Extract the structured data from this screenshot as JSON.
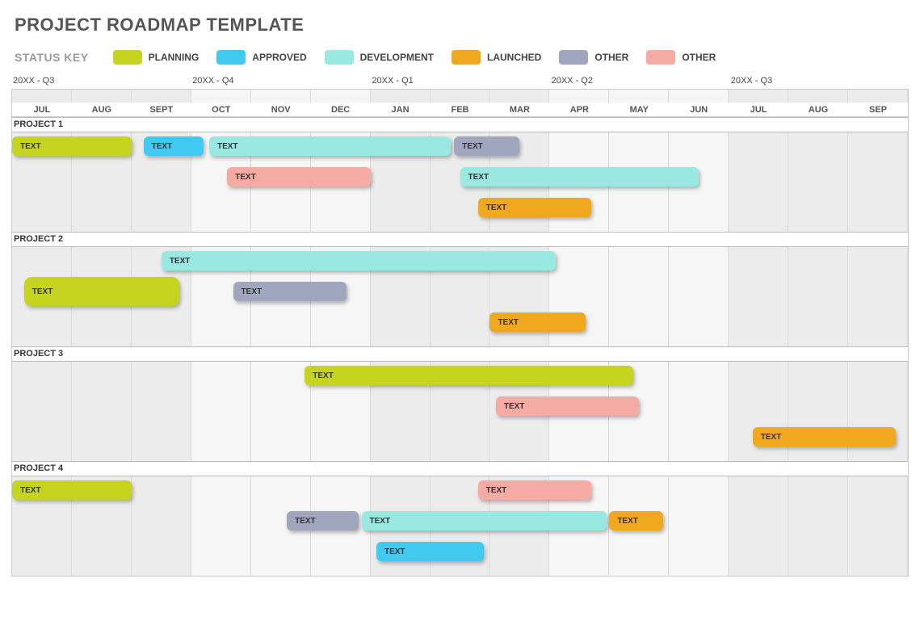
{
  "title": "PROJECT ROADMAP TEMPLATE",
  "legend": {
    "label": "STATUS KEY",
    "items": [
      {
        "key": "planning",
        "label": "PLANNING",
        "color": "#c6d420"
      },
      {
        "key": "approved",
        "label": "APPROVED",
        "color": "#41caf1"
      },
      {
        "key": "development",
        "label": "DEVELOPMENT",
        "color": "#9ae8e2"
      },
      {
        "key": "launched",
        "label": "LAUNCHED",
        "color": "#f0a81e"
      },
      {
        "key": "other1",
        "label": "OTHER",
        "color": "#9fa6bd"
      },
      {
        "key": "other2",
        "label": "OTHER",
        "color": "#f5aaa3"
      }
    ]
  },
  "months": [
    "JUL",
    "AUG",
    "SEPT",
    "OCT",
    "NOV",
    "DEC",
    "JAN",
    "FEB",
    "MAR",
    "APR",
    "MAY",
    "JUN",
    "JUL",
    "AUG",
    "SEP"
  ],
  "quarters": [
    {
      "label": "20XX - Q3",
      "start_month": 0
    },
    {
      "label": "20XX - Q4",
      "start_month": 3
    },
    {
      "label": "20XX - Q1",
      "start_month": 6
    },
    {
      "label": "20XX - Q2",
      "start_month": 9
    },
    {
      "label": "20XX - Q3",
      "start_month": 12
    }
  ],
  "projects": [
    {
      "name": "PROJECT 1",
      "rows": 3,
      "bars": [
        {
          "label": "TEXT",
          "status": "planning",
          "start": 0,
          "end": 2,
          "row": 0
        },
        {
          "label": "TEXT",
          "status": "approved",
          "start": 2.2,
          "end": 3.2,
          "row": 0
        },
        {
          "label": "TEXT",
          "status": "development",
          "start": 3.3,
          "end": 7.35,
          "row": 0
        },
        {
          "label": "TEXT",
          "status": "other1",
          "start": 7.4,
          "end": 8.5,
          "row": 0
        },
        {
          "label": "TEXT",
          "status": "other2",
          "start": 3.6,
          "end": 6,
          "row": 1
        },
        {
          "label": "TEXT",
          "status": "development",
          "start": 7.5,
          "end": 11.5,
          "row": 1
        },
        {
          "label": "TEXT",
          "status": "launched",
          "start": 7.8,
          "end": 9.7,
          "row": 2
        }
      ]
    },
    {
      "name": "PROJECT 2",
      "rows": 3,
      "bars": [
        {
          "label": "TEXT",
          "status": "development",
          "start": 2.5,
          "end": 9.1,
          "row": 0
        },
        {
          "label": "TEXT",
          "status": "planning",
          "start": 0.2,
          "end": 2.8,
          "row": 1,
          "size": "lg"
        },
        {
          "label": "TEXT",
          "status": "other1",
          "start": 3.7,
          "end": 5.6,
          "row": 1
        },
        {
          "label": "TEXT",
          "status": "launched",
          "start": 8,
          "end": 9.6,
          "row": 2
        }
      ]
    },
    {
      "name": "PROJECT 3",
      "rows": 3,
      "bars": [
        {
          "label": "TEXT",
          "status": "planning",
          "start": 4.9,
          "end": 10.4,
          "row": 0
        },
        {
          "label": "TEXT",
          "status": "other2",
          "start": 8.1,
          "end": 10.5,
          "row": 1
        },
        {
          "label": "TEXT",
          "status": "launched",
          "start": 12.4,
          "end": 14.8,
          "row": 2
        }
      ]
    },
    {
      "name": "PROJECT 4",
      "rows": 3,
      "bars": [
        {
          "label": "TEXT",
          "status": "planning",
          "start": 0,
          "end": 2,
          "row": 0
        },
        {
          "label": "TEXT",
          "status": "other2",
          "start": 7.8,
          "end": 9.7,
          "row": 0
        },
        {
          "label": "TEXT",
          "status": "other1",
          "start": 4.6,
          "end": 5.8,
          "row": 1
        },
        {
          "label": "TEXT",
          "status": "development",
          "start": 5.85,
          "end": 9.95,
          "row": 1
        },
        {
          "label": "TEXT",
          "status": "launched",
          "start": 10,
          "end": 10.9,
          "row": 1
        },
        {
          "label": "TEXT",
          "status": "approved",
          "start": 6.1,
          "end": 7.9,
          "row": 2
        }
      ]
    }
  ],
  "chart_data": {
    "type": "gantt",
    "title": "PROJECT ROADMAP TEMPLATE",
    "x_axis": {
      "months": [
        "JUL",
        "AUG",
        "SEPT",
        "OCT",
        "NOV",
        "DEC",
        "JAN",
        "FEB",
        "MAR",
        "APR",
        "MAY",
        "JUN",
        "JUL",
        "AUG",
        "SEP"
      ],
      "quarters": [
        "20XX - Q3",
        "20XX - Q4",
        "20XX - Q1",
        "20XX - Q2",
        "20XX - Q3"
      ]
    },
    "status_colors": {
      "planning": "#c6d420",
      "approved": "#41caf1",
      "development": "#9ae8e2",
      "launched": "#f0a81e",
      "other1": "#9fa6bd",
      "other2": "#f5aaa3"
    },
    "series": [
      {
        "name": "PROJECT 1",
        "tasks": [
          {
            "label": "TEXT",
            "status": "planning",
            "start_month": 0,
            "end_month": 2
          },
          {
            "label": "TEXT",
            "status": "approved",
            "start_month": 2.2,
            "end_month": 3.2
          },
          {
            "label": "TEXT",
            "status": "development",
            "start_month": 3.3,
            "end_month": 7.35
          },
          {
            "label": "TEXT",
            "status": "other1",
            "start_month": 7.4,
            "end_month": 8.5
          },
          {
            "label": "TEXT",
            "status": "other2",
            "start_month": 3.6,
            "end_month": 6
          },
          {
            "label": "TEXT",
            "status": "development",
            "start_month": 7.5,
            "end_month": 11.5
          },
          {
            "label": "TEXT",
            "status": "launched",
            "start_month": 7.8,
            "end_month": 9.7
          }
        ]
      },
      {
        "name": "PROJECT 2",
        "tasks": [
          {
            "label": "TEXT",
            "status": "development",
            "start_month": 2.5,
            "end_month": 9.1
          },
          {
            "label": "TEXT",
            "status": "planning",
            "start_month": 0.2,
            "end_month": 2.8
          },
          {
            "label": "TEXT",
            "status": "other1",
            "start_month": 3.7,
            "end_month": 5.6
          },
          {
            "label": "TEXT",
            "status": "launched",
            "start_month": 8,
            "end_month": 9.6
          }
        ]
      },
      {
        "name": "PROJECT 3",
        "tasks": [
          {
            "label": "TEXT",
            "status": "planning",
            "start_month": 4.9,
            "end_month": 10.4
          },
          {
            "label": "TEXT",
            "status": "other2",
            "start_month": 8.1,
            "end_month": 10.5
          },
          {
            "label": "TEXT",
            "status": "launched",
            "start_month": 12.4,
            "end_month": 14.8
          }
        ]
      },
      {
        "name": "PROJECT 4",
        "tasks": [
          {
            "label": "TEXT",
            "status": "planning",
            "start_month": 0,
            "end_month": 2
          },
          {
            "label": "TEXT",
            "status": "other2",
            "start_month": 7.8,
            "end_month": 9.7
          },
          {
            "label": "TEXT",
            "status": "other1",
            "start_month": 4.6,
            "end_month": 5.8
          },
          {
            "label": "TEXT",
            "status": "development",
            "start_month": 5.85,
            "end_month": 9.95
          },
          {
            "label": "TEXT",
            "status": "launched",
            "start_month": 10,
            "end_month": 10.9
          },
          {
            "label": "TEXT",
            "status": "approved",
            "start_month": 6.1,
            "end_month": 7.9
          }
        ]
      }
    ]
  }
}
